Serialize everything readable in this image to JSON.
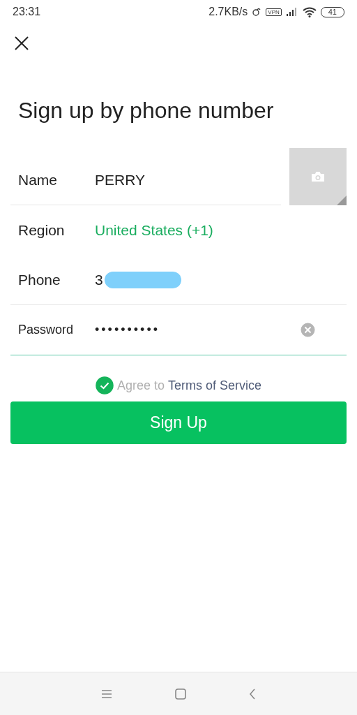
{
  "status_bar": {
    "time": "23:31",
    "network_speed": "2.7KB/s",
    "vpn_badge": "VPN",
    "battery": "41"
  },
  "title": "Sign up by phone number",
  "fields": [
    {
      "kind": "text",
      "label": "Name",
      "value": "PERRY"
    },
    {
      "kind": "link",
      "label": "Region",
      "value": "United States (+1)"
    },
    {
      "kind": "redacted",
      "label": "Phone",
      "value": "3"
    },
    {
      "kind": "password",
      "label": "Password",
      "value": "••••••••••",
      "focused": true
    }
  ],
  "agreement": {
    "checked": true,
    "prefix": "Agree to",
    "link": "Terms of Service"
  },
  "submit_button": "Sign Up"
}
